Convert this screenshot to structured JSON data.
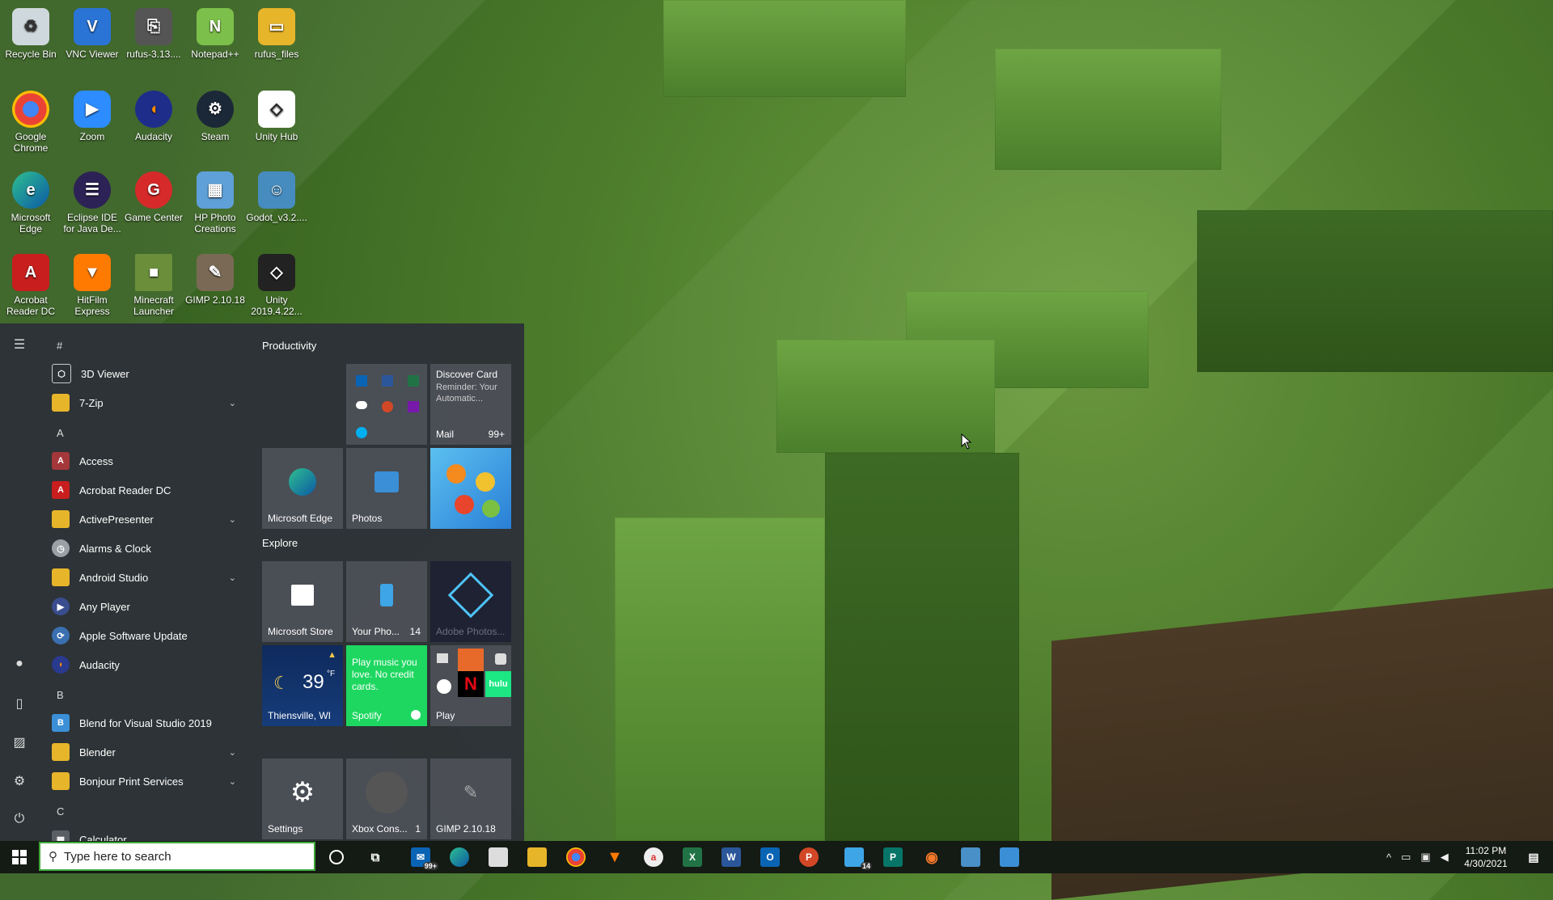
{
  "desktop_icons": [
    {
      "label": "Recycle Bin",
      "icon": "recycle-bin-icon"
    },
    {
      "label": "VNC Viewer",
      "icon": "vnc-icon"
    },
    {
      "label": "rufus-3.13....",
      "icon": "usb-icon"
    },
    {
      "label": "Notepad++",
      "icon": "notepad-icon"
    },
    {
      "label": "rufus_files",
      "icon": "folder-icon"
    },
    {
      "label": "Google Chrome",
      "icon": "chrome-icon"
    },
    {
      "label": "Zoom",
      "icon": "zoom-icon"
    },
    {
      "label": "Audacity",
      "icon": "audacity-icon"
    },
    {
      "label": "Steam",
      "icon": "steam-icon"
    },
    {
      "label": "Unity Hub",
      "icon": "unity-icon"
    },
    {
      "label": "Microsoft Edge",
      "icon": "edge-icon"
    },
    {
      "label": "Eclipse IDE for Java De...",
      "icon": "eclipse-icon"
    },
    {
      "label": "Game Center",
      "icon": "gamecenter-icon"
    },
    {
      "label": "HP Photo Creations",
      "icon": "photo-icon"
    },
    {
      "label": "Godot_v3.2....",
      "icon": "godot-icon"
    },
    {
      "label": "Acrobat Reader DC",
      "icon": "acrobat-icon"
    },
    {
      "label": "HitFilm Express",
      "icon": "hitfilm-icon"
    },
    {
      "label": "Minecraft Launcher",
      "icon": "minecraft-icon"
    },
    {
      "label": "GIMP 2.10.18",
      "icon": "gimp-icon"
    },
    {
      "label": "Unity 2019.4.22...",
      "icon": "unity-icon"
    }
  ],
  "start_menu": {
    "letters": [
      "#",
      "A",
      "B",
      "C"
    ],
    "apps": [
      {
        "label": "3D Viewer",
        "icon": "cube-icon",
        "color": "#2f3338",
        "expand": false
      },
      {
        "label": "7-Zip",
        "icon": "folder-icon",
        "color": "#e7b52a",
        "expand": true
      },
      {
        "label": "Access",
        "icon": "access-icon",
        "color": "#a4373a",
        "expand": false
      },
      {
        "label": "Acrobat Reader DC",
        "icon": "acrobat-icon",
        "color": "#c81e1e",
        "expand": false
      },
      {
        "label": "ActivePresenter",
        "icon": "folder-icon",
        "color": "#e7b52a",
        "expand": true
      },
      {
        "label": "Alarms & Clock",
        "icon": "clock-icon",
        "color": "#9aa0a6",
        "expand": false
      },
      {
        "label": "Android Studio",
        "icon": "folder-icon",
        "color": "#e7b52a",
        "expand": true
      },
      {
        "label": "Any Player",
        "icon": "player-icon",
        "color": "#3a4d8f",
        "expand": false
      },
      {
        "label": "Apple Software Update",
        "icon": "apple-update-icon",
        "color": "#3a6fb0",
        "expand": false
      },
      {
        "label": "Audacity",
        "icon": "audacity-icon",
        "color": "#2a3a8f",
        "expand": false
      },
      {
        "label": "Blend for Visual Studio 2019",
        "icon": "blend-icon",
        "color": "#3b8fd6",
        "expand": false
      },
      {
        "label": "Blender",
        "icon": "folder-icon",
        "color": "#e7b52a",
        "expand": true
      },
      {
        "label": "Bonjour Print Services",
        "icon": "folder-icon",
        "color": "#e7b52a",
        "expand": true
      },
      {
        "label": "Calculator",
        "icon": "calculator-icon",
        "color": "#5a5f66",
        "expand": false
      }
    ],
    "groups": [
      "Productivity",
      "Explore"
    ],
    "tiles": {
      "mail_title": "Discover Card",
      "mail_body": "Reminder: Your Automatic...",
      "mail_label": "Mail",
      "mail_count": "99+",
      "edge": "Microsoft Edge",
      "photos": "Photos",
      "store": "Microsoft Store",
      "phone": "Your Pho...",
      "phone_count": "14",
      "adobe": "Adobe Photos...",
      "weather_temp": "39",
      "weather_unit": "°F",
      "weather_city": "Thiensville, WI",
      "spotify_text": "Play music you love. No credit cards.",
      "spotify_label": "Spotify",
      "play_label": "Play",
      "settings": "Settings",
      "xbox": "Xbox Cons...",
      "xbox_count": "1",
      "gimp": "GIMP 2.10.18"
    }
  },
  "taskbar": {
    "search_placeholder": "Type here to search",
    "mail_badge": "99+",
    "files_badge": "14",
    "time": "11:02 PM",
    "date": "4/30/2021"
  }
}
